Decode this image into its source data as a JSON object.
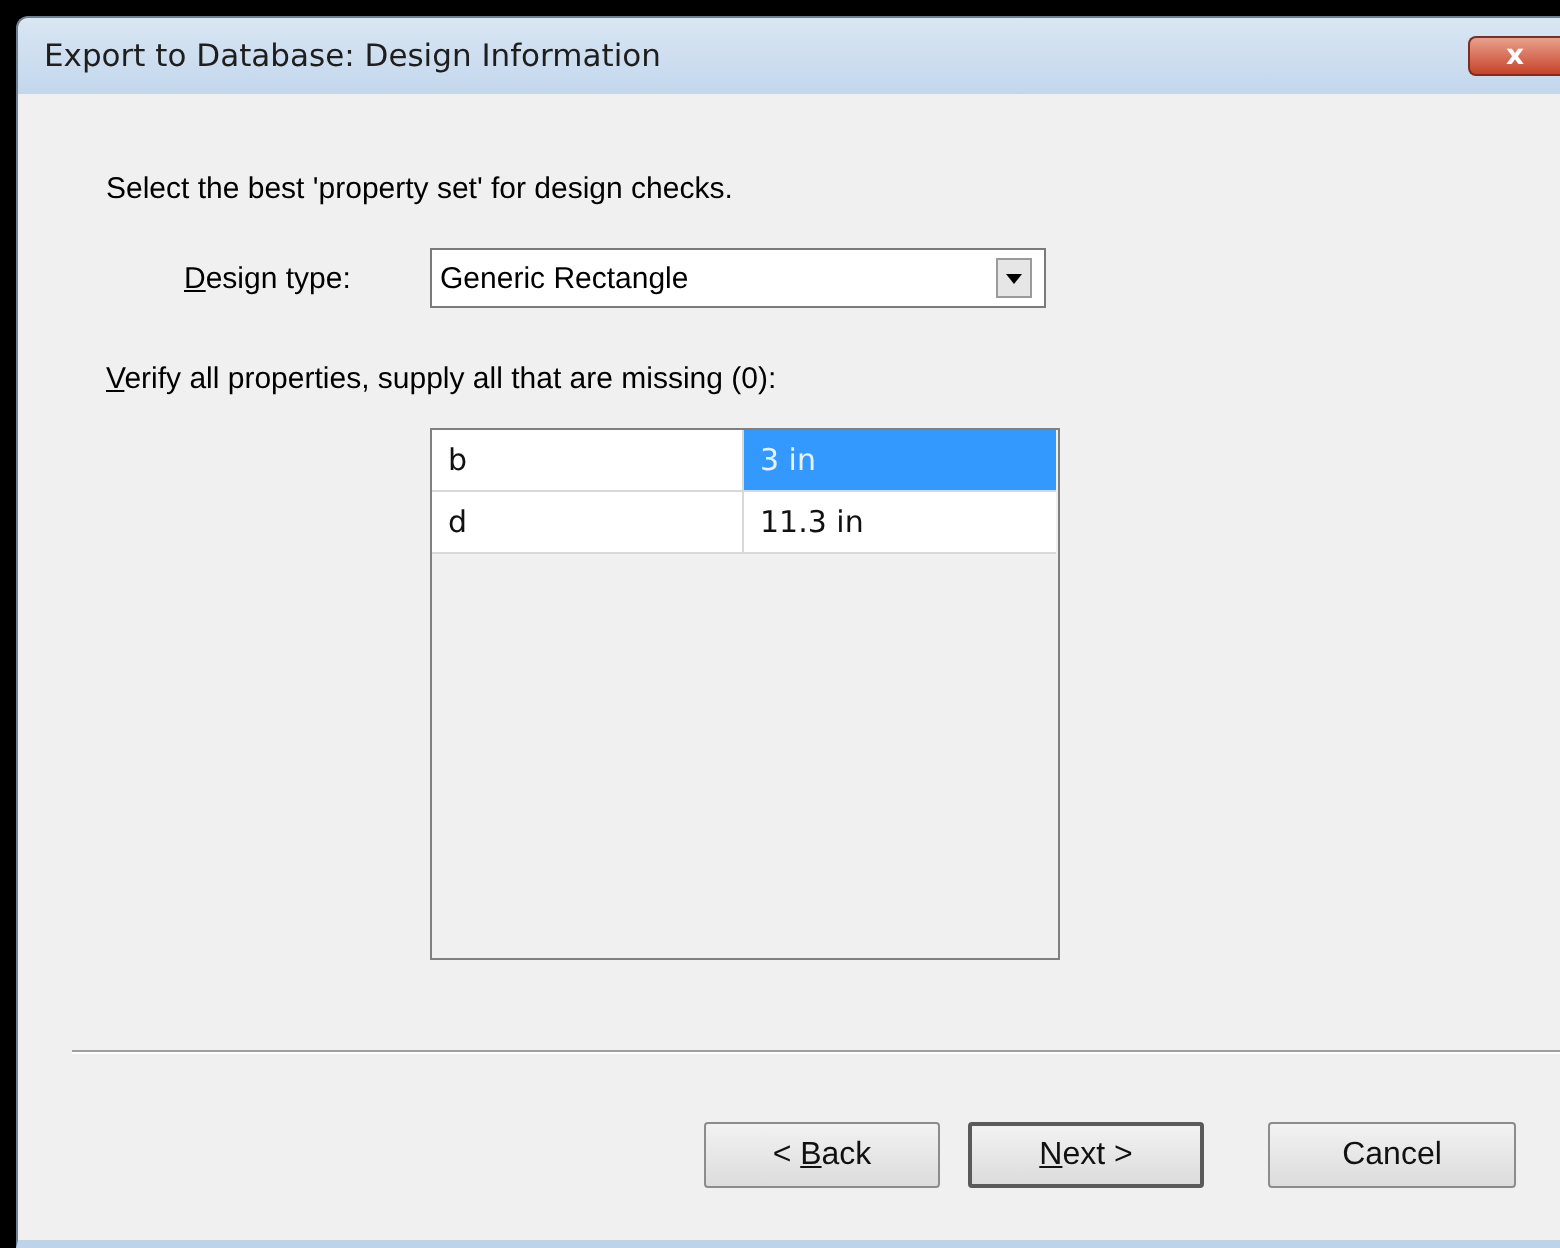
{
  "window": {
    "title": "Export to Database: Design Information",
    "close_icon": "x"
  },
  "intro": "Select the best 'property set' for design checks.",
  "design_type": {
    "label": {
      "mnemonic": "D",
      "rest": "esign type:"
    },
    "value": "Generic Rectangle"
  },
  "verify_label": {
    "mnemonic": "V",
    "rest": "erify all properties, supply all that are missing (0):"
  },
  "table": {
    "rows": [
      {
        "cells": [
          {
            "text": "b",
            "selected": false
          },
          {
            "text": "3 in",
            "selected": true
          }
        ]
      },
      {
        "cells": [
          {
            "text": "d",
            "selected": false
          },
          {
            "text": "11.3 in",
            "selected": false
          }
        ]
      }
    ]
  },
  "buttons": [
    {
      "prefix": "< ",
      "mnemonic": "B",
      "rest": "ack",
      "default": false
    },
    {
      "mnemonic": "N",
      "rest": "ext >",
      "default": true
    },
    {
      "rest": "Cancel",
      "default": false
    }
  ]
}
